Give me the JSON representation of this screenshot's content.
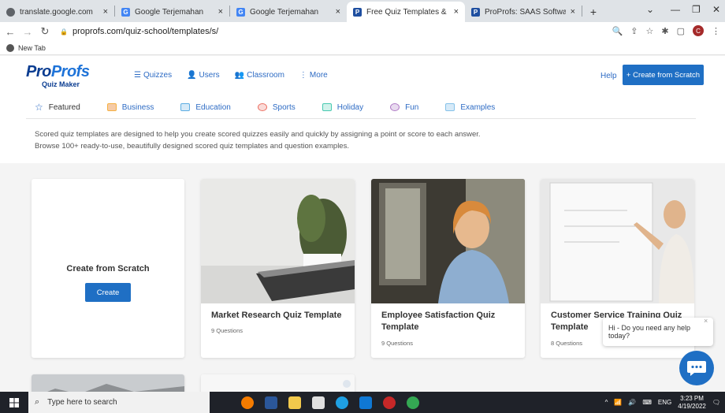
{
  "browser": {
    "tabs": [
      {
        "title": "translate.google.com",
        "color": "#5f6368",
        "glyph": ""
      },
      {
        "title": "Google Terjemahan",
        "color": "#4285f4",
        "glyph": "G"
      },
      {
        "title": "Google Terjemahan",
        "color": "#4285f4",
        "glyph": "G"
      },
      {
        "title": "Free Quiz Templates & Exam",
        "color": "#1f4fa0",
        "glyph": "P"
      },
      {
        "title": "ProProfs: SAAS Software for",
        "color": "#1f4fa0",
        "glyph": "P"
      }
    ],
    "active_tab": 3,
    "new_tab_symbol": "+",
    "url": "proprofs.com/quiz-school/templates/s/",
    "profile_initial": "C",
    "bookmark": "New Tab"
  },
  "site": {
    "logo_pro": "Pro",
    "logo_profs": "Profs",
    "logo_sub": "Quiz Maker",
    "nav": [
      {
        "icon": "☰",
        "label": "Quizzes"
      },
      {
        "icon": "👤",
        "label": "Users"
      },
      {
        "icon": "👥",
        "label": "Classroom"
      },
      {
        "icon": "⋮",
        "label": "More"
      }
    ],
    "help": "Help",
    "create_button": "+ Create from Scratch"
  },
  "categories": [
    {
      "label": "Featured",
      "color": "#ffffff"
    },
    {
      "label": "Business",
      "color": "#f5b041"
    },
    {
      "label": "Education",
      "color": "#5dade2"
    },
    {
      "label": "Sports",
      "color": "#ec7063"
    },
    {
      "label": "Holiday",
      "color": "#48c9b0"
    },
    {
      "label": "Fun",
      "color": "#af7ac5"
    },
    {
      "label": "Examples",
      "color": "#85c1e9"
    }
  ],
  "description": {
    "line1": "Scored quiz templates are designed to help you create scored quizzes easily and quickly by assigning a point or score to each answer.",
    "line2": "Browse 100+ ready-to-use, beautifully designed scored quiz templates and question examples."
  },
  "scratch_card": {
    "title": "Create from Scratch",
    "button": "Create"
  },
  "templates": [
    {
      "title": "Market Research Quiz Template",
      "meta": "9 Questions"
    },
    {
      "title": "Employee Satisfaction Quiz Template",
      "meta": "9 Questions"
    },
    {
      "title": "Customer Service Training Quiz Template",
      "meta": "8 Questions"
    }
  ],
  "chat": {
    "message": "Hi - Do you need any help today?",
    "close": "×"
  },
  "taskbar": {
    "search_placeholder": "Type here to search",
    "lang": "ENG",
    "time": "3:23 PM",
    "date": "4/19/2022"
  },
  "colors": {
    "accent": "#1f6fc4",
    "link": "#2d6bc4",
    "logo_dark": "#0b3d91"
  }
}
